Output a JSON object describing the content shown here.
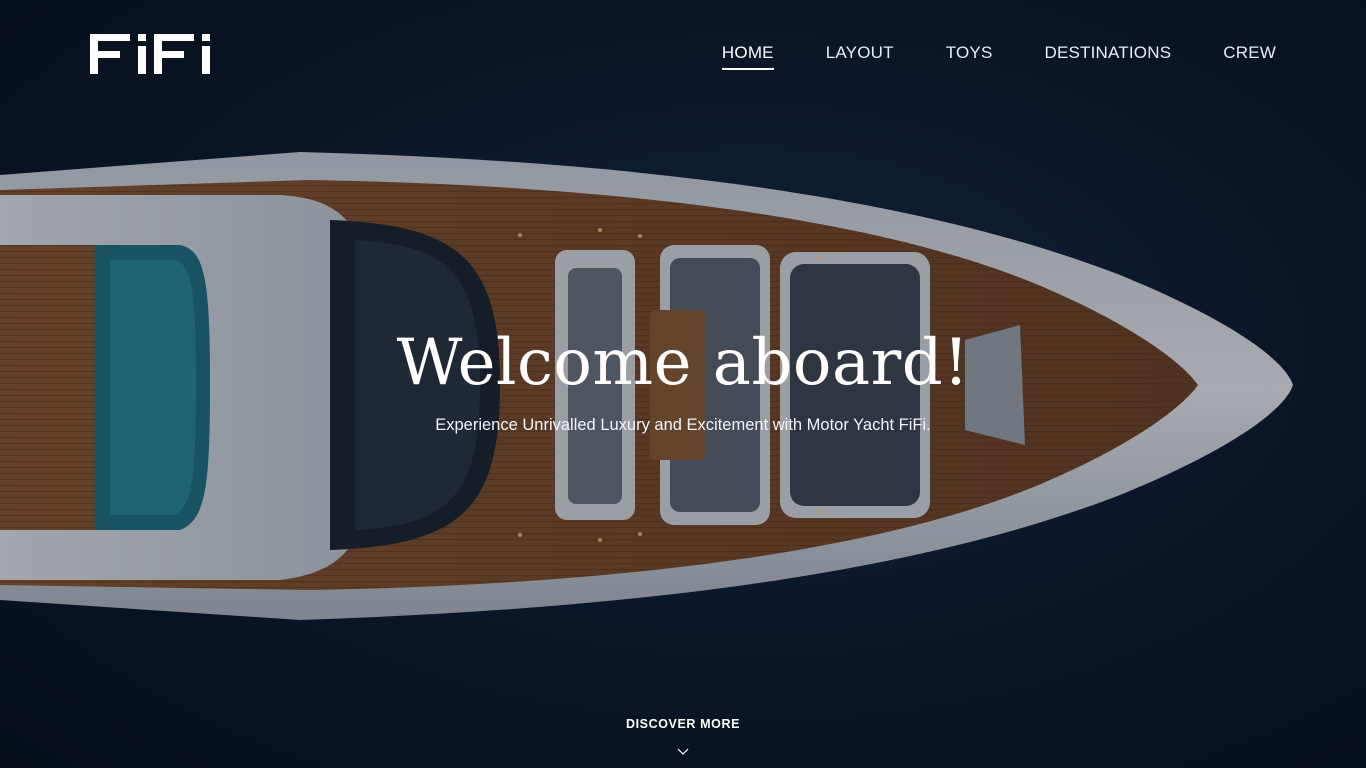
{
  "brand": {
    "logo_text": "FiFi"
  },
  "nav": {
    "items": [
      {
        "label": "HOME",
        "active": true
      },
      {
        "label": "LAYOUT",
        "active": false
      },
      {
        "label": "TOYS",
        "active": false
      },
      {
        "label": "DESTINATIONS",
        "active": false
      },
      {
        "label": "CREW",
        "active": false
      }
    ]
  },
  "hero": {
    "title": "Welcome aboard!",
    "subtitle": "Experience Unrivalled Luxury and Excitement with Motor Yacht FiFi.",
    "cta_label": "DISCOVER MORE",
    "cta_icon": "chevron-down-icon"
  },
  "colors": {
    "sea": "#0d1a2c",
    "hull": "#d9dde2",
    "deck_wood": "#7a4a2a",
    "text": "#ffffff"
  }
}
